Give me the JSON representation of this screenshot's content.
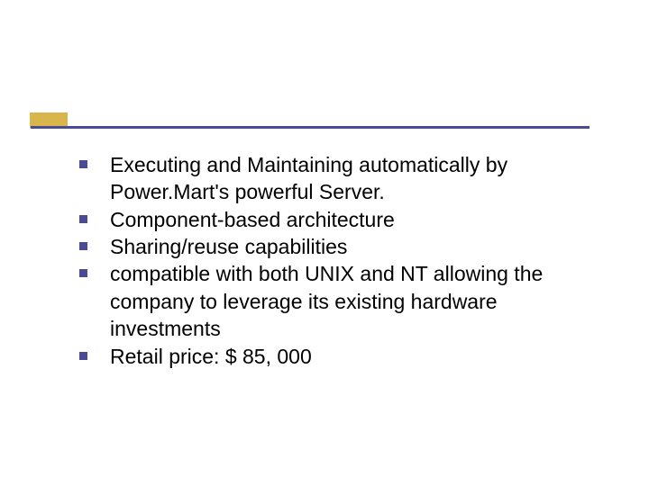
{
  "slide": {
    "bullets": [
      "Executing and Maintaining automatically by Power.Mart's powerful Server.",
      "Component-based architecture",
      "Sharing/reuse capabilities",
      "compatible with both UNIX and NT allowing the company to leverage its existing hardware investments",
      "Retail price: $ 85, 000"
    ]
  },
  "colors": {
    "rule": "#4a4a95",
    "accent": "#d8b64c",
    "bullet": "#4a4a95"
  }
}
